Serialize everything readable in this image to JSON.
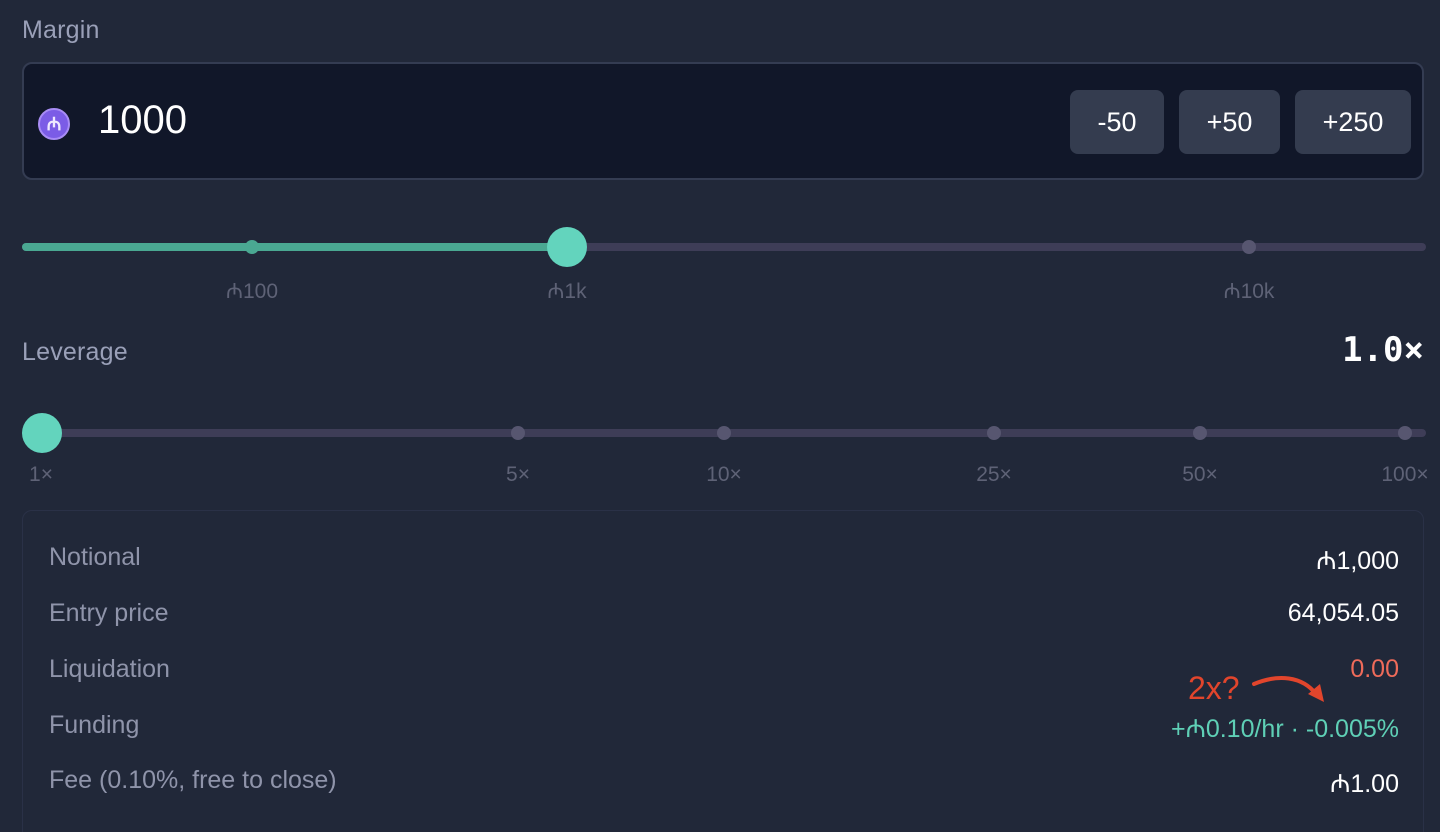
{
  "margin": {
    "label": "Margin",
    "currency_symbol": "₼",
    "value": "1000",
    "buttons": [
      "-50",
      "+50",
      "+250"
    ],
    "slider": {
      "ticks": [
        "₼100",
        "₼1k",
        "₼10k"
      ],
      "value": "₼1k"
    }
  },
  "leverage": {
    "label": "Leverage",
    "value": "1.0×",
    "slider": {
      "ticks": [
        "1×",
        "5×",
        "10×",
        "25×",
        "50×",
        "100×"
      ],
      "value": "1×"
    }
  },
  "stats": {
    "notional": {
      "label": "Notional",
      "value": "₼1,000"
    },
    "entry_price": {
      "label": "Entry price",
      "value": "64,054.05"
    },
    "liquidation": {
      "label": "Liquidation",
      "value": "0.00"
    },
    "funding": {
      "label": "Funding",
      "value": "+₼0.10/hr · -0.005%"
    },
    "fee": {
      "label": "Fee (0.10%, free to close)",
      "value": "₼1.00"
    }
  },
  "annotation": {
    "text": "2x?"
  },
  "colors": {
    "background": "#212839",
    "accent": "#63d4bd",
    "negative": "#ef6b5a",
    "annotation": "#e2452c"
  }
}
